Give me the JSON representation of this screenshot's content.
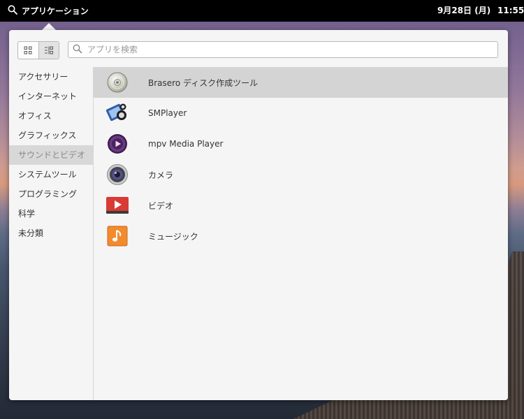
{
  "panel": {
    "applications_label": "アプリケーション",
    "date": "9月28日 (月)",
    "time": "11:55"
  },
  "launcher": {
    "search_placeholder": "アプリを検索",
    "categories": [
      {
        "label": "アクセサリー"
      },
      {
        "label": "インターネット"
      },
      {
        "label": "オフィス"
      },
      {
        "label": "グラフィックス"
      },
      {
        "label": "サウンドとビデオ"
      },
      {
        "label": "システムツール"
      },
      {
        "label": "プログラミング"
      },
      {
        "label": "科学"
      },
      {
        "label": "未分類"
      }
    ],
    "selected_category": "サウンドとビデオ",
    "apps": [
      {
        "label": "Brasero ディスク作成ツール",
        "icon": "disc-icon"
      },
      {
        "label": "SMPlayer",
        "icon": "smplayer-icon"
      },
      {
        "label": "mpv Media Player",
        "icon": "mpv-icon"
      },
      {
        "label": "カメラ",
        "icon": "camera-icon"
      },
      {
        "label": "ビデオ",
        "icon": "video-icon"
      },
      {
        "label": "ミュージック",
        "icon": "music-icon"
      }
    ]
  },
  "colors": {
    "panel_bg": "#000000",
    "popover_bg": "#f5f5f5",
    "selected_row": "#d4d4d4"
  }
}
